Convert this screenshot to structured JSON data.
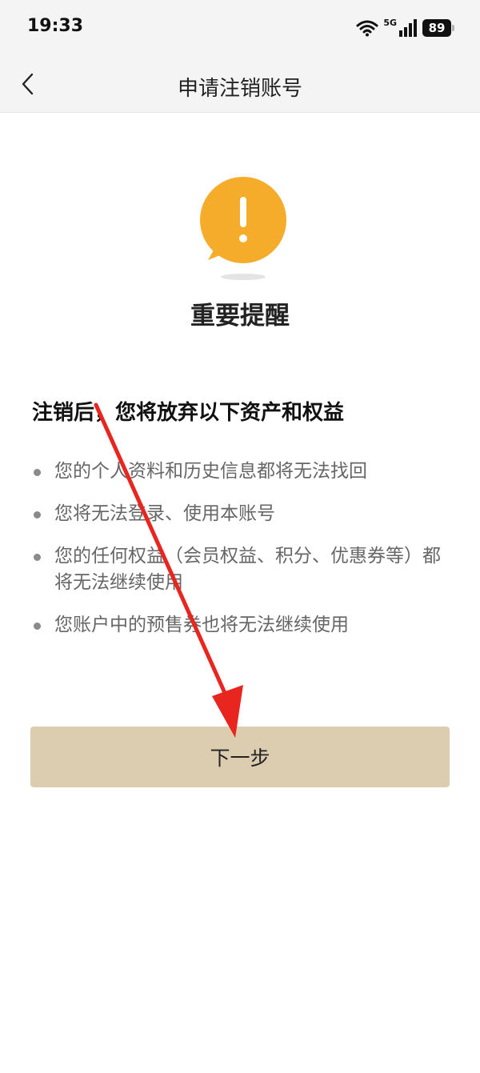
{
  "status_bar": {
    "time": "19:33",
    "network": "5G",
    "battery": "89",
    "icons": [
      "wifi-icon",
      "signal-icon",
      "battery-icon"
    ]
  },
  "nav": {
    "title": "申请注销账号",
    "back_icon": "chevron-left-icon"
  },
  "main": {
    "icon": "exclamation-bubble-icon",
    "headline": "重要提醒",
    "section_title": "注销后，您将放弃以下资产和权益",
    "items": [
      {
        "text": "您的个人资料和历史信息都将无法找回"
      },
      {
        "text": "您将无法登录、使用本账号"
      },
      {
        "text": "您的任何权益（会员权益、积分、优惠券等）都将无法继续使用"
      },
      {
        "text": "您账户中的预售券也将无法继续使用"
      }
    ],
    "next_button": "下一步"
  },
  "colors": {
    "warning": "#f5ac2b",
    "button_bg": "#dccdb0",
    "annotation_arrow": "#e8261f"
  }
}
